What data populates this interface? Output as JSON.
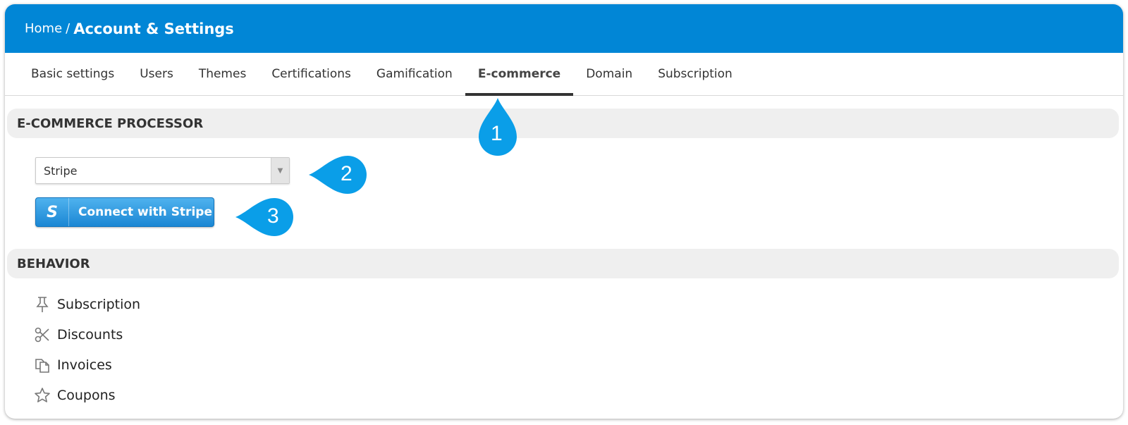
{
  "header": {
    "breadcrumb_home": "Home",
    "breadcrumb_separator": "/",
    "title": "Account & Settings",
    "color": "#0186d6"
  },
  "tabs": [
    {
      "label": "Basic settings",
      "active": false
    },
    {
      "label": "Users",
      "active": false
    },
    {
      "label": "Themes",
      "active": false
    },
    {
      "label": "Certifications",
      "active": false
    },
    {
      "label": "Gamification",
      "active": false
    },
    {
      "label": "E-commerce",
      "active": true
    },
    {
      "label": "Domain",
      "active": false
    },
    {
      "label": "Subscription",
      "active": false
    }
  ],
  "ecommerce": {
    "section_title": "E-COMMERCE PROCESSOR",
    "processor_select_value": "Stripe",
    "connect_button_label": "Connect with Stripe",
    "connect_button_icon_letter": "S",
    "button_color": "#1b87d4"
  },
  "behavior": {
    "section_title": "BEHAVIOR",
    "items": [
      {
        "label": "Subscription",
        "icon": "pin-icon"
      },
      {
        "label": "Discounts",
        "icon": "scissors-icon"
      },
      {
        "label": "Invoices",
        "icon": "documents-icon"
      },
      {
        "label": "Coupons",
        "icon": "star-icon"
      }
    ]
  },
  "callouts": [
    {
      "number": "1"
    },
    {
      "number": "2"
    },
    {
      "number": "3"
    }
  ],
  "callout_color": "#0a9ee8"
}
